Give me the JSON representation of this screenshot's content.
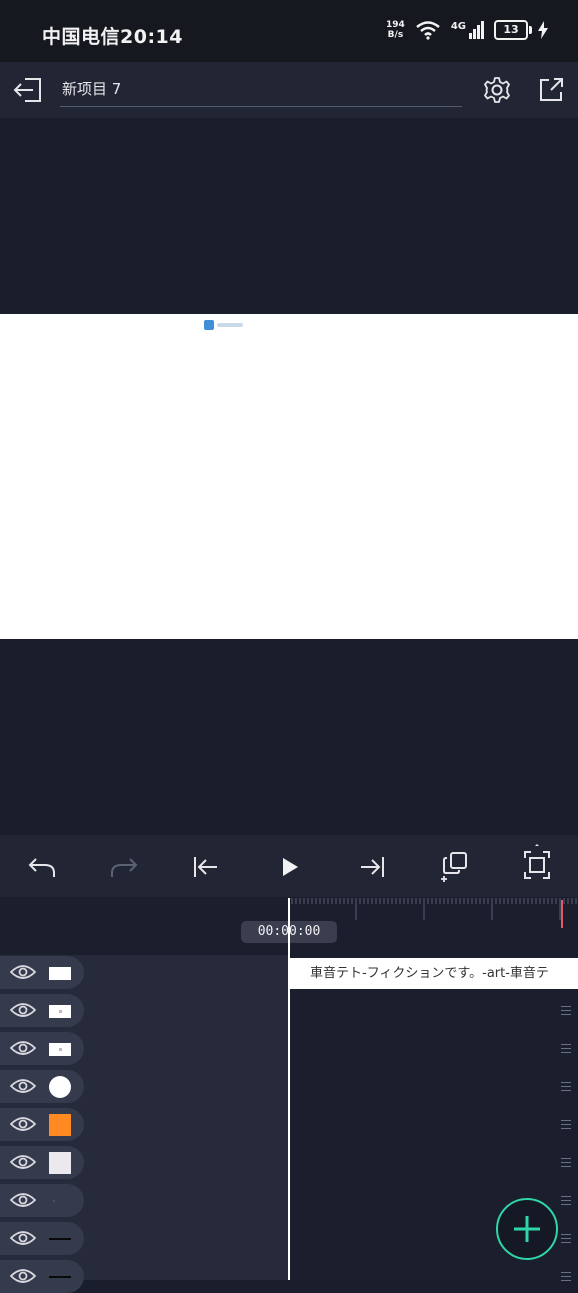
{
  "status_bar": {
    "carrier_time": "中国电信20:14",
    "net_speed_value": "194",
    "net_speed_unit": "B/s",
    "network": "4G",
    "battery": "13"
  },
  "header": {
    "project_title": "新项目 7"
  },
  "timeline": {
    "timecode": "00:00:00",
    "clip_text": "車音テト-フィクションです。-art-車音テ"
  },
  "icons": {
    "back": "exit-icon",
    "settings": "gear-icon",
    "export": "share-icon",
    "undo": "undo-icon",
    "redo": "redo-icon",
    "to_start": "skip-start-icon",
    "play": "play-icon",
    "to_end": "skip-end-icon",
    "duplicate": "duplicate-icon",
    "fit": "fit-screen-icon",
    "add": "plus-icon"
  },
  "colors": {
    "accent": "#2fd7a6",
    "playhead_marker": "#e05a6a",
    "orange_layer": "#ff8a22"
  },
  "layers": [
    {
      "thumb": "white-rect"
    },
    {
      "thumb": "white-rect-small"
    },
    {
      "thumb": "white-rect-small"
    },
    {
      "thumb": "white-circle"
    },
    {
      "thumb": "orange-square"
    },
    {
      "thumb": "light-square"
    },
    {
      "thumb": "dot"
    },
    {
      "thumb": "black-line"
    },
    {
      "thumb": "black-line"
    }
  ]
}
